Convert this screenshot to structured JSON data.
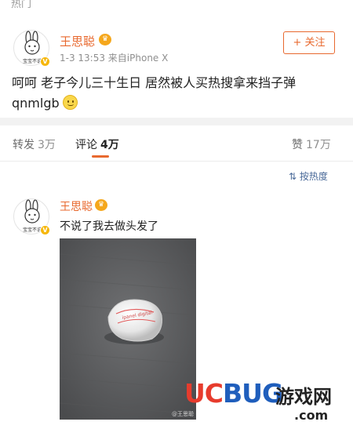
{
  "top": {
    "section_label": "热门"
  },
  "post": {
    "author": "王思聪",
    "avatar_caption": "宝宝不说",
    "meta": "1-3 13:53  来自iPhone X",
    "follow_label": "+ 关注",
    "text_line1": "呵呵 老子今儿三十生日 居然被人买热搜拿来挡子弹",
    "text_line2": "qnmlgb",
    "emoji_icon": "smile-emoji-icon"
  },
  "tabs": [
    {
      "label": "转发",
      "count": "3万"
    },
    {
      "label": "评论",
      "count": "4万"
    },
    {
      "label": "赞",
      "count": "17万"
    }
  ],
  "sort": {
    "label": "按热度",
    "icon": "sort-icon"
  },
  "comment": {
    "author": "王思聪",
    "text": "不说了我去做头发了",
    "photo_object_text": "ipanel digital",
    "photo_watermark": "@王思聪"
  },
  "brand": {
    "main": "UCBUG",
    "cn": "游戏网",
    "domain": ".com"
  },
  "colors": {
    "accent": "#e8692f",
    "link": "#4a6a99",
    "brand_red": "#e73c2d",
    "brand_blue": "#1f5ebc"
  }
}
